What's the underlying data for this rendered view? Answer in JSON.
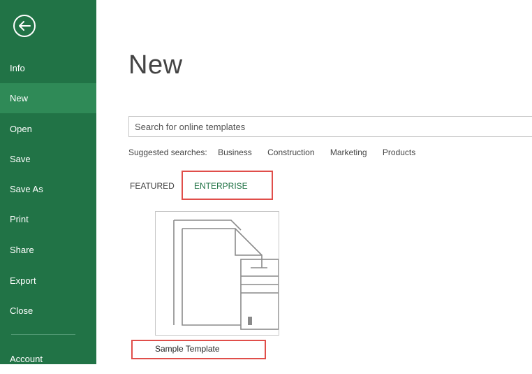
{
  "sidebar": {
    "items": [
      {
        "label": "Info"
      },
      {
        "label": "New"
      },
      {
        "label": "Open"
      },
      {
        "label": "Save"
      },
      {
        "label": "Save As"
      },
      {
        "label": "Print"
      },
      {
        "label": "Share"
      },
      {
        "label": "Export"
      },
      {
        "label": "Close"
      },
      {
        "label": "Account"
      }
    ],
    "active": "New"
  },
  "main": {
    "title": "New",
    "search_placeholder": "Search for online templates",
    "suggested_label": "Suggested searches:",
    "suggested": [
      "Business",
      "Construction",
      "Marketing",
      "Products"
    ],
    "tabs": [
      {
        "label": "FEATURED"
      },
      {
        "label": "ENTERPRISE"
      }
    ],
    "templates": [
      {
        "label": "Sample Template",
        "icon": "document-template-icon"
      }
    ]
  },
  "colors": {
    "sidebar_bg": "#217346",
    "sidebar_active": "#2f8a57",
    "accent": "#217346",
    "highlight": "#e04e4a"
  }
}
